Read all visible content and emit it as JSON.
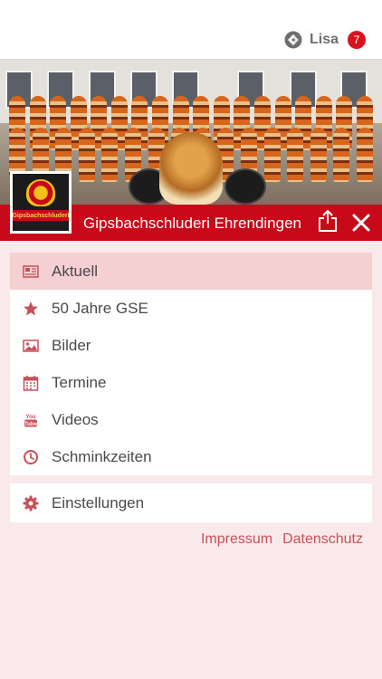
{
  "header": {
    "user_name": "Lisa",
    "notification_count": "7"
  },
  "hero": {
    "club_name": "Gipsbachschluderi Ehrendingen",
    "logo_text": "Gipsbachschluderi"
  },
  "menu": {
    "items": [
      {
        "label": "Aktuell",
        "icon": "newspaper-icon",
        "active": true
      },
      {
        "label": "50 Jahre GSE",
        "icon": "star-icon",
        "active": false
      },
      {
        "label": "Bilder",
        "icon": "image-icon",
        "active": false
      },
      {
        "label": "Termine",
        "icon": "calendar-icon",
        "active": false
      },
      {
        "label": "Videos",
        "icon": "youtube-icon",
        "active": false
      },
      {
        "label": "Schminkzeiten",
        "icon": "clock-icon",
        "active": false
      }
    ],
    "settings_label": "Einstellungen"
  },
  "footer": {
    "impressum": "Impressum",
    "datenschutz": "Datenschutz"
  },
  "colors": {
    "brand_red": "#c8091a",
    "icon_red": "#c75058",
    "active_row": "#f5d0d2",
    "background": "#fae9ea"
  }
}
